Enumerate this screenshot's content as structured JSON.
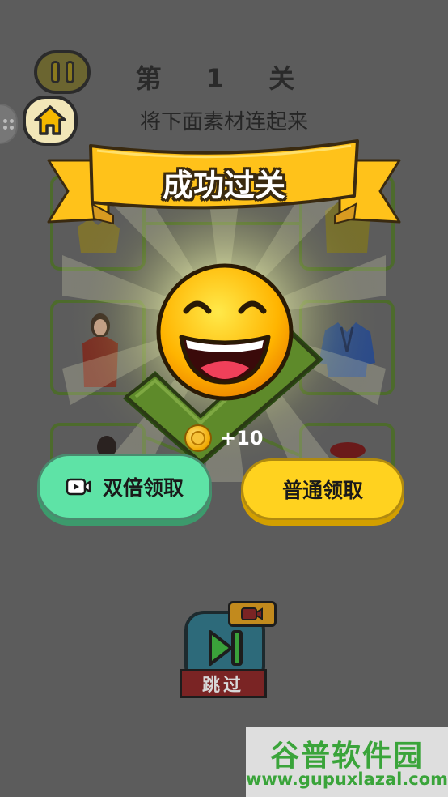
{
  "header": {
    "level_title": "第 1 关",
    "instruction": "将下面素材连起来"
  },
  "banner": {
    "text": "成功过关"
  },
  "reward": {
    "amount": "+10"
  },
  "buttons": {
    "double_label": "双倍领取",
    "normal_label": "普通领取",
    "skip_label": "跳过"
  },
  "icons": {
    "pause": "pause-icon",
    "home": "home-icon",
    "menu": "dots-grid-icon",
    "video": "video-camera-icon",
    "skip": "play-skip-icon",
    "coin": "coin-icon"
  },
  "colors": {
    "background": "#5c5c5c",
    "ribbon": "#ffc21a",
    "double_button": "#5ee3a6",
    "normal_button": "#ffd21f",
    "check": "#5e8a2a",
    "watermark": "#3aa43a"
  },
  "watermark": {
    "brand": "谷普软件园",
    "url": "www.gupuxlazal.com"
  }
}
